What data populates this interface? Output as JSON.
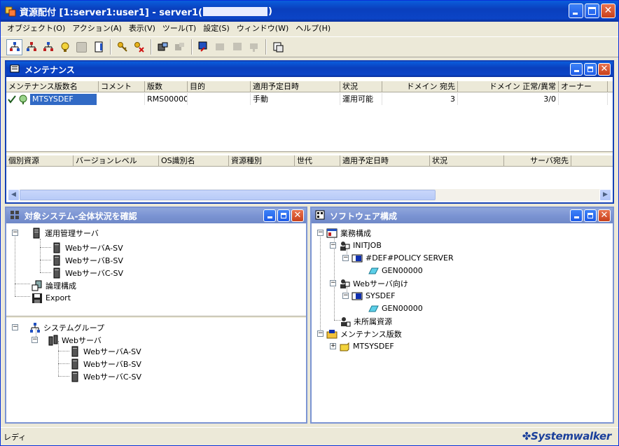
{
  "main_window": {
    "title": "資源配付 [1:server1:user1] - server1(",
    "title_suffix": ")",
    "redacted_fill": "#e8ecff"
  },
  "menu": [
    "オブジェクト(O)",
    "アクション(A)",
    "表示(V)",
    "ツール(T)",
    "設定(S)",
    "ウィンドウ(W)",
    "ヘルプ(H)"
  ],
  "toolbar": {
    "groups": [
      [
        "server-tree-icon",
        "server-tree-icon-2",
        "server-tree-icon-3"
      ],
      [
        "resource-icon",
        "disabled-icon",
        "document-icon"
      ],
      [
        "key-icon",
        "key-delete-icon"
      ],
      [
        "transfer-icon",
        "transfer-disabled-icon"
      ],
      [
        "window-icon",
        "window-disabled-icon",
        "window-disabled-icon-2",
        "window-disabled-icon-3"
      ],
      [
        "print-icon"
      ]
    ]
  },
  "maintenance": {
    "title": "メンテナンス",
    "columns": [
      "メンテナンス版数名",
      "コメント",
      "版数",
      "目的",
      "適用予定日時",
      "状況",
      "ドメイン 宛先",
      "ドメイン 正常/異常",
      "オーナー"
    ],
    "rows": [
      {
        "name": "MTSYSDEF",
        "comment": "",
        "version": "RMS00000",
        "purpose": "",
        "schedule": "手動",
        "status": "運用可能",
        "dest": "3",
        "result": "3/0",
        "owner": ""
      }
    ],
    "sub_columns": [
      "個別資源",
      "バージョンレベル",
      "OS識別名",
      "資源種別",
      "世代",
      "適用予定日時",
      "状況",
      "サーバ宛先"
    ]
  },
  "system_panel": {
    "title": "対象システム-全体状況を確認",
    "tree1": [
      {
        "label": "運用管理サーバ",
        "children": [
          "WebサーバA-SV",
          "WebサーバB-SV",
          "WebサーバC-SV"
        ]
      },
      {
        "label": "論理構成"
      },
      {
        "label": "Export"
      }
    ],
    "tree2": {
      "root": "システムグループ",
      "group": "Webサーバ",
      "children": [
        "WebサーバA-SV",
        "WebサーバB-SV",
        "WebサーバC-SV"
      ]
    }
  },
  "software_panel": {
    "title": "ソフトウェア構成",
    "tree": {
      "root": "業務構成",
      "job1": "INITJOB",
      "job1_child": "#DEF#POLICY SERVER",
      "job1_gen": "GEN00000",
      "job2": "Webサーバ向け",
      "job2_child": "SYSDEF",
      "job2_gen": "GEN00000",
      "unassigned": "未所属資源",
      "maint": "メンテナンス版数",
      "maint_child": "MTSYSDEF"
    }
  },
  "status": {
    "text": "レディ",
    "logo": "Systemwalker"
  },
  "colors": {
    "accent": "#0a3fbd",
    "selection": "#316ac5"
  }
}
